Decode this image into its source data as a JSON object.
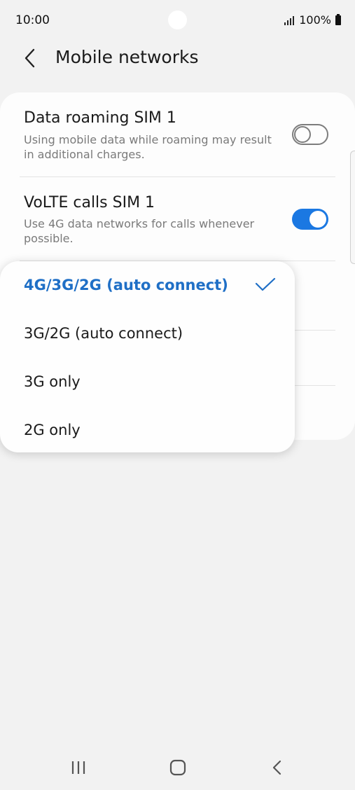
{
  "status_bar": {
    "time": "10:00",
    "battery": "100%"
  },
  "header": {
    "title": "Mobile networks"
  },
  "settings": [
    {
      "title": "Data roaming SIM 1",
      "subtitle": "Using mobile data while roaming may result in additional charges.",
      "toggle": "off"
    },
    {
      "title": "VoLTE calls SIM 1",
      "subtitle": "Use 4G data networks for calls whenever possible.",
      "toggle": "on"
    }
  ],
  "network_mode_menu": {
    "options": [
      {
        "label": "4G/3G/2G (auto connect)",
        "selected": true
      },
      {
        "label": "3G/2G (auto connect)",
        "selected": false
      },
      {
        "label": "3G only",
        "selected": false
      },
      {
        "label": "2G only",
        "selected": false
      }
    ]
  },
  "colors": {
    "accent": "#1b78e2",
    "selected_text": "#1f6fc6",
    "background": "#f2f2f2"
  },
  "icons": [
    "back-arrow-icon",
    "check-icon",
    "recent-apps-icon",
    "home-icon",
    "nav-back-icon",
    "signal-icon",
    "battery-icon"
  ]
}
